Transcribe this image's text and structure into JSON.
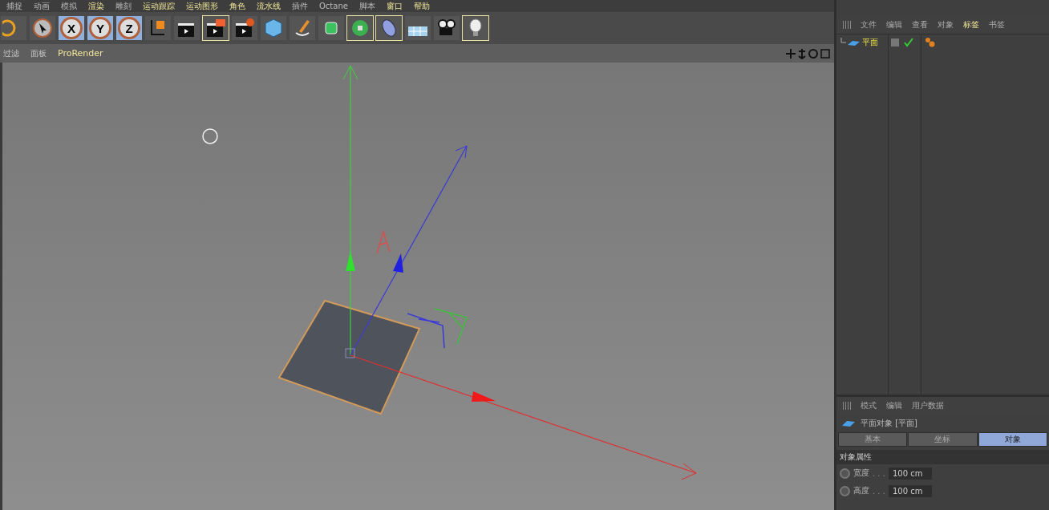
{
  "menu": [
    {
      "label": "捕捉",
      "highlighted": false
    },
    {
      "label": "动画",
      "highlighted": false
    },
    {
      "label": "模拟",
      "highlighted": false
    },
    {
      "label": "渲染",
      "highlighted": true
    },
    {
      "label": "雕刻",
      "highlighted": false
    },
    {
      "label": "运动跟踪",
      "highlighted": true
    },
    {
      "label": "运动图形",
      "highlighted": true
    },
    {
      "label": "角色",
      "highlighted": true
    },
    {
      "label": "流水线",
      "highlighted": true
    },
    {
      "label": "插件",
      "highlighted": false
    },
    {
      "label": "Octane",
      "highlighted": false
    },
    {
      "label": "脚本",
      "highlighted": false
    },
    {
      "label": "窗口",
      "highlighted": true
    },
    {
      "label": "帮助",
      "highlighted": true
    }
  ],
  "toolbar": [
    {
      "kind": "undo",
      "selected": false,
      "outlined": false
    },
    {
      "kind": "cursor",
      "selected": false,
      "outlined": false
    },
    {
      "kind": "axis",
      "label": "X",
      "selected": true,
      "outlined": false
    },
    {
      "kind": "axis",
      "label": "Y",
      "selected": true,
      "outlined": false
    },
    {
      "kind": "axis",
      "label": "Z",
      "selected": true,
      "outlined": false
    },
    {
      "kind": "coord",
      "selected": false,
      "outlined": false
    },
    {
      "kind": "render-view",
      "selected": false,
      "outlined": false
    },
    {
      "kind": "render-picture",
      "selected": false,
      "outlined": true
    },
    {
      "kind": "render-settings",
      "selected": false,
      "outlined": false
    },
    {
      "kind": "cube",
      "selected": false,
      "outlined": false
    },
    {
      "kind": "pen",
      "selected": false,
      "outlined": false
    },
    {
      "kind": "subdivision",
      "selected": false,
      "outlined": false
    },
    {
      "kind": "cloner",
      "selected": false,
      "outlined": true
    },
    {
      "kind": "deformer",
      "selected": false,
      "outlined": true
    },
    {
      "kind": "floor",
      "selected": false,
      "outlined": false
    },
    {
      "kind": "camera",
      "selected": false,
      "outlined": false
    },
    {
      "kind": "light",
      "selected": false,
      "outlined": true
    }
  ],
  "viewport": {
    "menu": [
      {
        "label": "过滤",
        "highlighted": false
      },
      {
        "label": "面板",
        "highlighted": false
      },
      {
        "label": "ProRender",
        "highlighted": true
      }
    ]
  },
  "object_manager": {
    "menu": [
      {
        "label": "文件",
        "highlighted": false
      },
      {
        "label": "编辑",
        "highlighted": false
      },
      {
        "label": "查看",
        "highlighted": false
      },
      {
        "label": "对象",
        "highlighted": false
      },
      {
        "label": "标签",
        "highlighted": true
      },
      {
        "label": "书签",
        "highlighted": false
      }
    ],
    "objects": [
      {
        "name": "平面",
        "selected": true
      }
    ]
  },
  "attribute_manager": {
    "menu": [
      "模式",
      "编辑",
      "用户数据"
    ],
    "title": "平面对象 [平面]",
    "tabs": [
      {
        "label": "基本",
        "selected": false
      },
      {
        "label": "坐标",
        "selected": false
      },
      {
        "label": "对象",
        "selected": true
      }
    ],
    "section": "对象属性",
    "fields": [
      {
        "label": "宽度",
        "dots": ". . .",
        "value": "100 cm",
        "checked": false
      },
      {
        "label": "高度",
        "dots": ". . .",
        "value": "100 cm",
        "checked": false
      }
    ]
  }
}
